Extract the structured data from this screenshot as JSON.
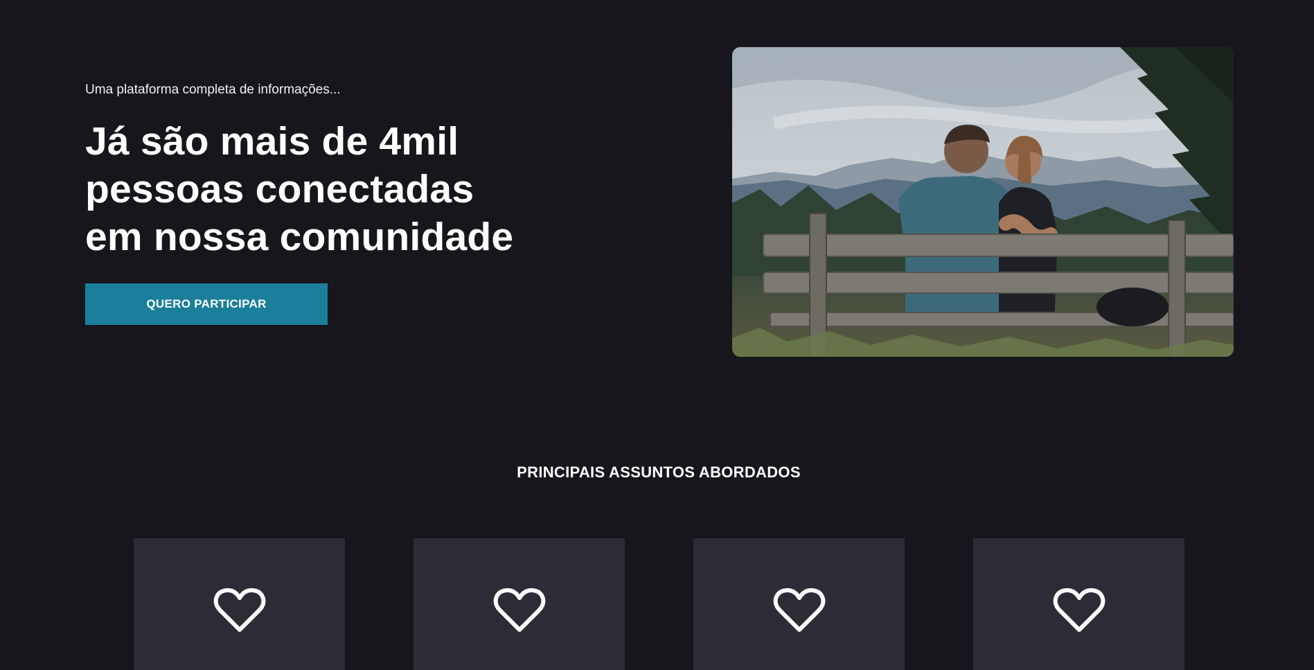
{
  "hero": {
    "eyebrow": "Uma plataforma completa de informações...",
    "headline_lines": [
      "Já são mais de 4mil",
      "pessoas conectadas",
      "em nossa comunidade"
    ],
    "cta_label": "QUERO PARTICIPAR",
    "accent_color": "#1b7e9a"
  },
  "topics": {
    "title": "PRINCIPAIS ASSUNTOS ABORDADOS",
    "cards": [
      {
        "icon": "heart-icon"
      },
      {
        "icon": "heart-icon"
      },
      {
        "icon": "heart-icon"
      },
      {
        "icon": "heart-icon"
      }
    ]
  },
  "colors": {
    "background": "#16161c",
    "card_background": "#2b2c36"
  }
}
